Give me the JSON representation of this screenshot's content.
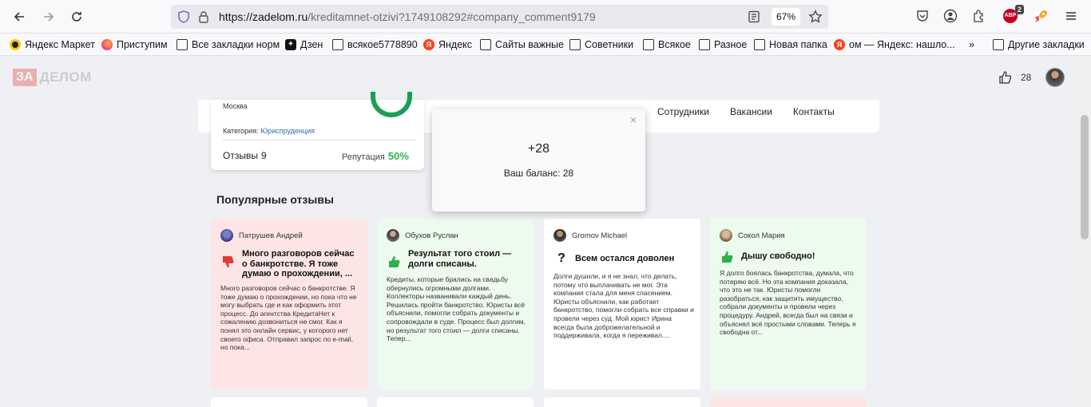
{
  "browser": {
    "url_main": "https://zadelom.ru",
    "url_rest": "/kreditamnet-otzivi?1749108292#company_comment9179",
    "zoom": "67%",
    "abp_label": "ABP",
    "abp_count": "2"
  },
  "bookmarks": [
    {
      "label": "Яндекс Маркет",
      "icon": "yandex-market-icon"
    },
    {
      "label": "Приступим",
      "icon": "firefox-icon"
    },
    {
      "label": "Все закладки норм",
      "icon": "folder-icon"
    },
    {
      "label": "Дзен",
      "icon": "dzen-icon"
    },
    {
      "label": "всякое5778890",
      "icon": "folder-icon"
    },
    {
      "label": "Яндекс",
      "icon": "yandex-icon"
    },
    {
      "label": "Сайты важные",
      "icon": "folder-icon"
    },
    {
      "label": "Советники",
      "icon": "folder-icon"
    },
    {
      "label": "Всякое",
      "icon": "folder-icon"
    },
    {
      "label": "Разное",
      "icon": "folder-icon"
    },
    {
      "label": "Новая папка",
      "icon": "folder-icon"
    },
    {
      "label": "ом — Яндекс: нашло...",
      "icon": "yandex-icon"
    },
    {
      "label": "Другие закладки",
      "icon": "folder-icon"
    }
  ],
  "site": {
    "logo_za": "ЗА",
    "logo_delom": "ДЕЛОМ",
    "likes": "28"
  },
  "company": {
    "city": "Москва",
    "category_label": "Категория:",
    "category_value": "Юриспруденция",
    "reviews_label": "Отзывы",
    "reviews_count": "9",
    "reputation_label": "Репутация",
    "reputation_value": "50%",
    "nav": [
      "Сотрудники",
      "Вакансии",
      "Контакты"
    ]
  },
  "popular_title": "Популярные отзывы",
  "reviews": [
    {
      "author": "Патрушев Андрей",
      "sentiment": "negative",
      "title": "Много разговоров сейчас о банкротстве. Я тоже думаю о прохождении, ...",
      "body": "Много разговоров сейчас о банкротстве. Я тоже думаю о прохождении, но пока что не могу выбрать где и как оформить этот процесс. До агентства КредитаНет к сожалению дозвониться не смог. Как я понял это онлайн сервис, у которого нет своего офиса. Отправил запрос по e-mail, но пока..."
    },
    {
      "author": "Обухов Руслан",
      "sentiment": "positive",
      "title": "Результат того стоил — долги списаны.",
      "body": "Кредиты, которые брались на свадьбу обернулись огромными долгами. Коллекторы названивали каждый день. Решилась пройти банкротство. Юристы всё объяснили, помогли собрать документы и сопровождали в суде. Процесс был долгим, но результат того стоил — долги списаны. Тепер..."
    },
    {
      "author": "Gromov Michael",
      "sentiment": "neutral",
      "title": "Всем остался доволен",
      "body": "Долги душили, и я не знал, что делать, потому что выплачивать не мог. Эта компания стала для меня спасением. Юристы объяснили, как работает банкротство, помогли собрать все справки и провели через суд. Мой юрист Ирина всегда была доброжелательной и поддерживала, когда я переживал...."
    },
    {
      "author": "Сокол Мария",
      "sentiment": "positive",
      "title": "Дышу свободно!",
      "body": "Я долго боялась банкротства, думала, что потеряю всё. Но эта компания доказала, что это не так. Юристы помогли разобраться, как защитить имущество, собрали документы и провели через процедуру. Андрей, всегда был на связи и объяснял всё простыми словами. Теперь я свободна от..."
    }
  ],
  "popup": {
    "close": "×",
    "plus": "+28",
    "balance": "Ваш баланс: 28"
  }
}
